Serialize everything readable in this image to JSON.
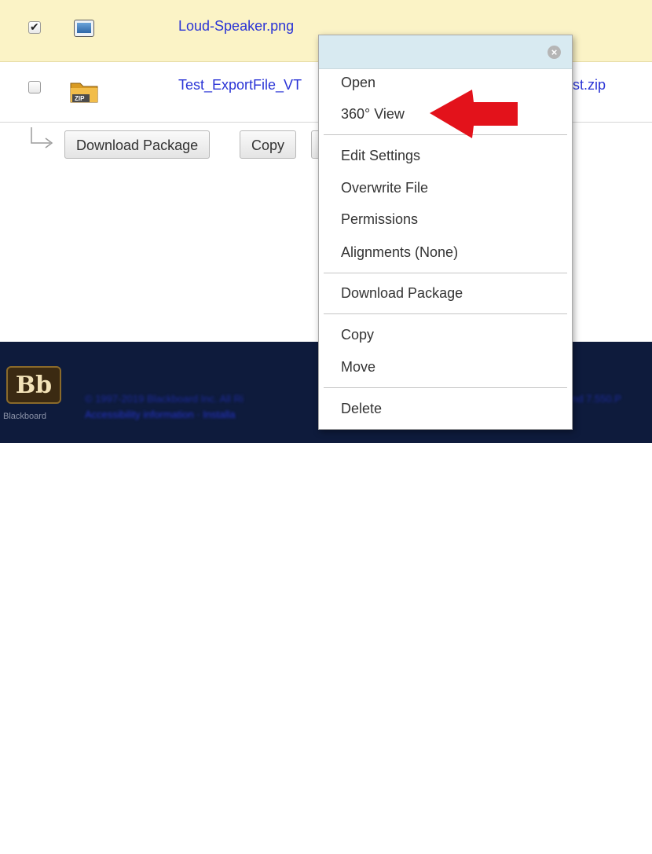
{
  "files": [
    {
      "name": "Loud-Speaker.png",
      "checked": true
    },
    {
      "name": "Test_ExportFile_VT",
      "name_suffix": "st.zip",
      "checked": false
    }
  ],
  "actions": {
    "download_package": "Download Package",
    "copy": "Copy"
  },
  "context_menu": {
    "close_glyph": "×",
    "groups": [
      [
        "Open",
        "360° View"
      ],
      [
        "Edit Settings",
        "Overwrite File",
        "Permissions",
        "Alignments (None)"
      ],
      [
        "Download Package"
      ],
      [
        "Copy",
        "Move"
      ],
      [
        "Delete"
      ]
    ]
  },
  "footer": {
    "logo_text": "Bb",
    "brand_word": "Blackboard",
    "copyright_blurred": "© 1997-2019 Blackboard Inc. All Ri",
    "links_blurred": "Accessibility information   ·   Installa",
    "version_blurred": "nd 7.550.P"
  },
  "colors": {
    "selected_row": "#fbf3c6",
    "link": "#2a34d6",
    "menu_header": "#d8eaf1",
    "footer_bg": "#0e1b3c",
    "annotation_arrow": "#e3121b"
  }
}
